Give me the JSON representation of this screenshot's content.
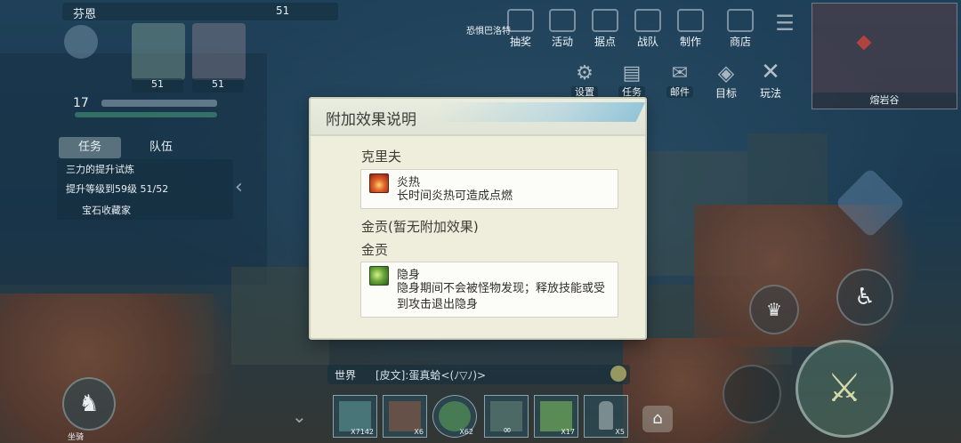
{
  "player": {
    "name": "芬恩",
    "level": "17",
    "team_levels": [
      "51",
      "51"
    ],
    "top_level": "51"
  },
  "top_menu": [
    {
      "label": "抽奖",
      "icon": "gift-icon"
    },
    {
      "label": "活动",
      "icon": "calendar-icon"
    },
    {
      "label": "据点",
      "icon": "flag-icon"
    },
    {
      "label": "战队",
      "icon": "shield-icon"
    },
    {
      "label": "制作",
      "icon": "hammer-icon"
    },
    {
      "label": "商店",
      "icon": "scale-icon"
    }
  ],
  "second_menu": [
    {
      "label": "设置",
      "icon": "gear-icon"
    },
    {
      "label": "任务",
      "icon": "ticket-icon"
    },
    {
      "label": "邮件",
      "icon": "mail-icon"
    },
    {
      "label": "目标",
      "icon": "target-icon"
    },
    {
      "label": "玩法",
      "icon": "swords-icon"
    }
  ],
  "event_banner": "恐惧巴洛特",
  "minimap_label": "熔岩谷",
  "left_tabs": {
    "task": "任务",
    "team": "队伍"
  },
  "quests": [
    "三力的提升试炼",
    "提升等级到59级 51/52",
    "宝石收藏家"
  ],
  "dialog": {
    "title": "附加效果说明",
    "sections": [
      {
        "name": "克里夫",
        "effect": {
          "name": "炎热",
          "desc": "长时间炎热可造成点燃",
          "icon": "fire-icon",
          "icon_color": "#b8331f"
        }
      },
      {
        "name": "金贡(暂无附加效果)"
      },
      {
        "name": "金贡",
        "effect": {
          "name": "隐身",
          "desc": "隐身期间不会被怪物发现；释放技能或受到攻击退出隐身",
          "icon": "stealth-icon",
          "icon_color": "#4f8a2a"
        }
      }
    ]
  },
  "chat": {
    "channel": "世界",
    "message": "[皮文]:蛋真蛤<(ﾉ▽ﾉ)>"
  },
  "hotbar": [
    {
      "count": "X7142"
    },
    {
      "count": "X6"
    },
    {
      "count": "X62"
    },
    {
      "count": "∞"
    },
    {
      "count": "X17"
    },
    {
      "count": "X5"
    }
  ],
  "mount_label": "坐骑"
}
